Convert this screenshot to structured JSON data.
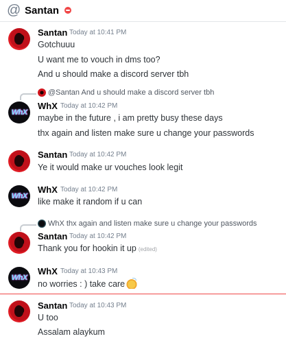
{
  "header": {
    "at_symbol": "@",
    "title": "Santan"
  },
  "messages": [
    {
      "author": "Santan",
      "timestamp": "Today at 10:41 PM",
      "lines": [
        "Gotchuuu",
        "U want me to vouch in dms too?",
        "And u should make a discord server tbh"
      ]
    },
    {
      "reply_to": "@Santan And u should make a discord server tbh",
      "author": "WhX",
      "timestamp": "Today at 10:42 PM",
      "lines": [
        "maybe in the future , i am pretty busy these days",
        "thx again and listen make sure u change your passwords"
      ]
    },
    {
      "author": "Santan",
      "timestamp": "Today at 10:42 PM",
      "lines": [
        "Ye it would make ur vouches look legit"
      ]
    },
    {
      "author": "WhX",
      "timestamp": "Today at 10:42 PM",
      "lines": [
        "like make it random if u can"
      ]
    },
    {
      "reply_to": "WhX thx again and listen make sure u change your passwords",
      "author": "Santan",
      "timestamp": "Today at 10:42 PM",
      "lines": [
        "Thank you for hookin it up"
      ],
      "edited_label": "(edited)"
    },
    {
      "author": "WhX",
      "timestamp": "Today at 10:43 PM",
      "lines": [
        "no worries : ) take care"
      ],
      "emoji": "clap-emoji"
    },
    {
      "author": "Santan",
      "timestamp": "Today at 10:43 PM",
      "lines": [
        "U too",
        "Assalam alaykum"
      ]
    }
  ],
  "avatar_text_whx": "WhX",
  "colors": {
    "new_messages_divider": "#f04747",
    "dnd_status": "#f04747"
  }
}
